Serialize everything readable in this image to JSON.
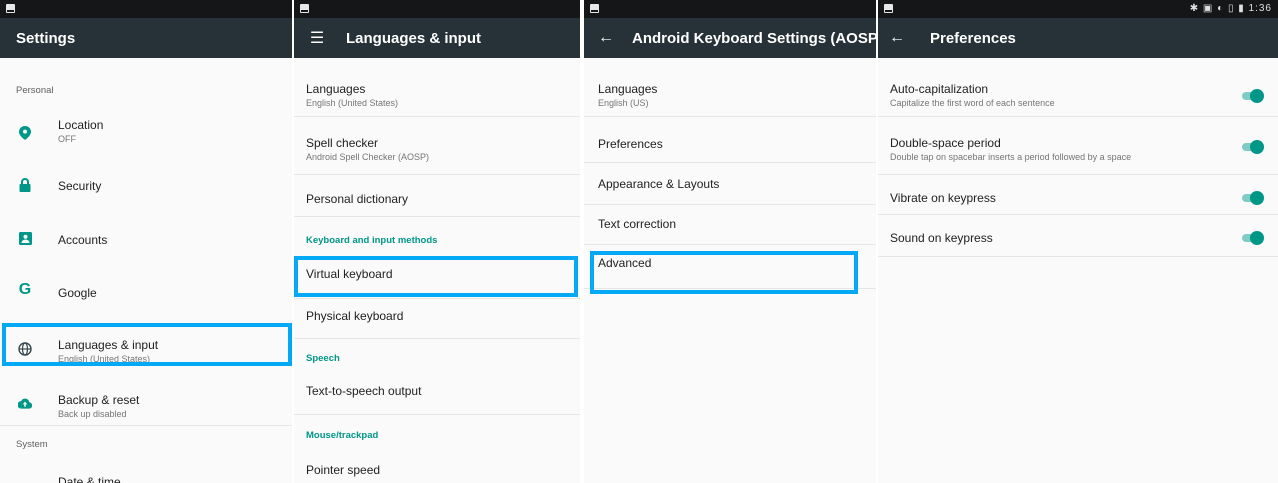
{
  "status": {
    "right": "✱ ▣ ◐ ▯ ▮ 1:36"
  },
  "p1": {
    "title": "Settings",
    "cat_personal": "Personal",
    "location": {
      "label": "Location",
      "sub": "OFF"
    },
    "security": "Security",
    "accounts": "Accounts",
    "google": "Google",
    "languages": {
      "label": "Languages & input",
      "sub": "English (United States)"
    },
    "backup": {
      "label": "Backup & reset",
      "sub": "Back up disabled"
    },
    "cat_system": "System",
    "datetime": "Date & time",
    "icons": {
      "location": "location-pin-icon",
      "security": "lock-icon",
      "accounts": "account-box-icon",
      "google": "google-g-icon",
      "languages": "globe-icon",
      "backup": "cloud-upload-icon",
      "datetime": "clock-icon"
    }
  },
  "p2": {
    "nav_icon": "menu-icon",
    "title": "Languages & input",
    "languages": {
      "label": "Languages",
      "sub": "English (United States)"
    },
    "spell": {
      "label": "Spell checker",
      "sub": "Android Spell Checker (AOSP)"
    },
    "dictionary": "Personal dictionary",
    "cat_keyboard": "Keyboard and input methods",
    "virtual": "Virtual keyboard",
    "physical": "Physical keyboard",
    "cat_speech": "Speech",
    "tts": "Text-to-speech output",
    "cat_mouse": "Mouse/trackpad",
    "pointer": "Pointer speed"
  },
  "p3": {
    "nav_icon": "back-arrow-icon",
    "title": "Android Keyboard Settings (AOSP)",
    "languages": {
      "label": "Languages",
      "sub": "English (US)"
    },
    "preferences": "Preferences",
    "appearance": "Appearance & Layouts",
    "correction": "Text correction",
    "advanced": "Advanced"
  },
  "p4": {
    "nav_icon": "back-arrow-icon",
    "title": "Preferences",
    "autocap": {
      "label": "Auto-capitalization",
      "sub": "Capitalize the first word of each sentence",
      "on": true
    },
    "doublespace": {
      "label": "Double-space period",
      "sub": "Double tap on spacebar inserts a period followed by a space",
      "on": true
    },
    "vibrate": {
      "label": "Vibrate on keypress",
      "on": true
    },
    "sound": {
      "label": "Sound on keypress",
      "on": true
    }
  },
  "colors": {
    "appbar": "#263238",
    "accent": "#009688",
    "highlight": "#03a9f4"
  }
}
